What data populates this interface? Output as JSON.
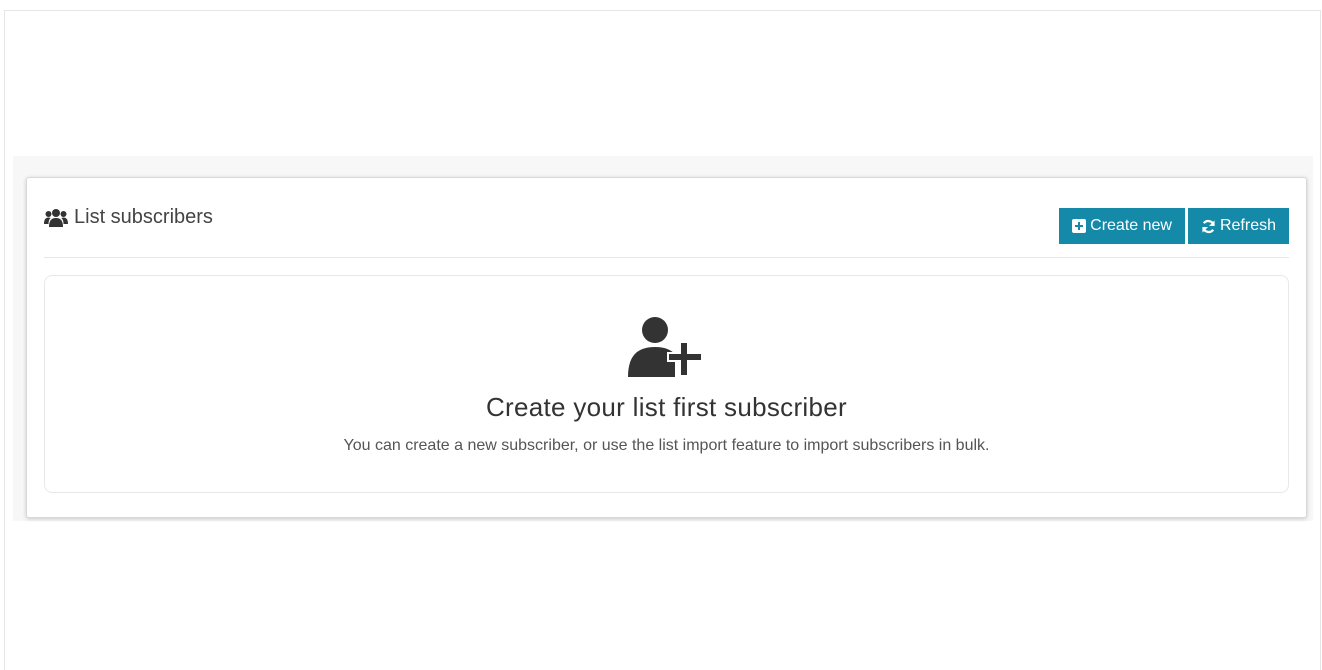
{
  "box": {
    "title": "List subscribers",
    "title_icon": "users-icon"
  },
  "buttons": {
    "create_new": "Create new",
    "create_new_icon": "plus-square-icon",
    "refresh": "Refresh",
    "refresh_icon": "refresh-icon"
  },
  "empty_state": {
    "icon": "user-plus-icon",
    "heading": "Create your list first subscriber",
    "text": "You can create a new subscriber, or use the list import feature to import subscribers in bulk."
  },
  "colors": {
    "button_bg": "#1589a8",
    "icon": "#333333"
  }
}
